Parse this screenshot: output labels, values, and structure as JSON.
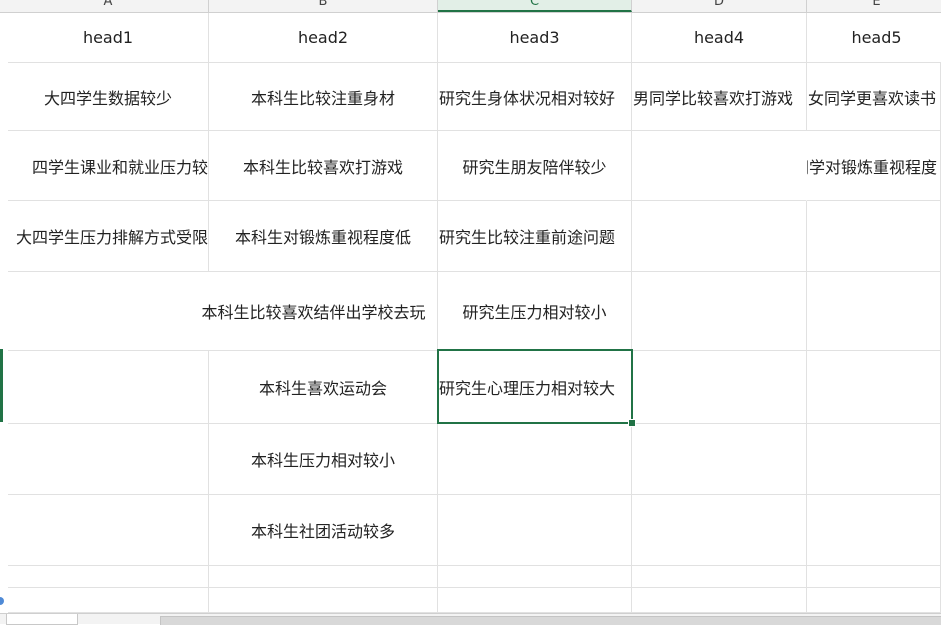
{
  "columns": [
    "A",
    "B",
    "C",
    "D",
    "E"
  ],
  "selected_column": "C",
  "rows": [
    {
      "cells": [
        "head1",
        "head2",
        "head3",
        "head4",
        "head5"
      ]
    },
    {
      "cells": [
        "大四学生数据较少",
        "本科生比较注重身材",
        "研究生身体状况相对较好",
        "男同学比较喜欢打游戏",
        "女同学更喜欢读书"
      ]
    },
    {
      "cells": [
        "四学生课业和就业压力较",
        "本科生比较喜欢打游戏",
        "研究生朋友陪伴较少",
        "",
        "女同学对锻炼重视程度"
      ]
    },
    {
      "cells": [
        "大四学生压力排解方式受限",
        "本科生对锻炼重视程度低",
        "研究生比较注重前途问题",
        "",
        ""
      ]
    },
    {
      "cells": [
        "",
        "本科生比较喜欢结伴出学校去玩",
        "研究生压力相对较小",
        "",
        ""
      ]
    },
    {
      "cells": [
        "",
        "本科生喜欢运动会",
        "研究生心理压力相对较大",
        "",
        ""
      ]
    },
    {
      "cells": [
        "",
        "本科生压力相对较小",
        "",
        "",
        ""
      ]
    },
    {
      "cells": [
        "",
        "本科生社团活动较多",
        "",
        "",
        ""
      ]
    }
  ],
  "active_cell": "C6",
  "colors": {
    "accent": "#217346",
    "gridline": "#e1e1e1",
    "header_bg": "#f3f3f3"
  }
}
